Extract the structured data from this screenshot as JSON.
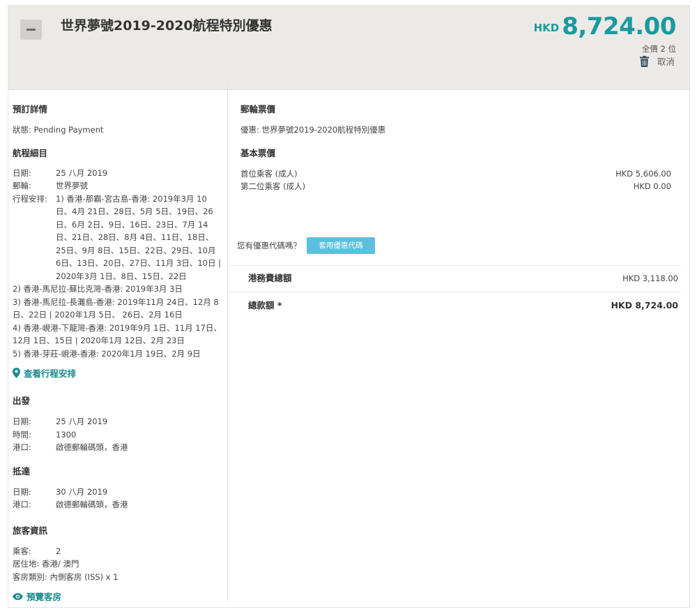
{
  "header": {
    "title": "世界夢號2019-2020航程特別優惠",
    "currency": "HKD",
    "amount": "8,724.00",
    "total_note": "全價 2 位",
    "cancel_label": "取消"
  },
  "booking": {
    "section_title": "預訂詳情",
    "status": "狀態: Pending Payment"
  },
  "voyage": {
    "section_title": "航程細目",
    "date_label": "日期:",
    "date_value": "25 八月 2019",
    "ship_label": "郵輪:",
    "ship_value": "世界夢號",
    "itinerary_label": "行程安排:",
    "itinerary_1": "1) 香港-那霸-宮古島-香港: 2019年3月 10日、4月 21日、28日、5月 5日、19日、26日、6月 2日、9日、16日、23日、7月 14日、21日、28日、8月 4日、11日、18日、25日、9月 8日、15日、22日、29日、10月 6日、13日、20日、27日、11月 3日、10日 | 2020年3月 1日、8日、15日、22日",
    "itinerary_2": "2) 香港-馬尼拉-蘇比克灣-香港: 2019年3月 3日",
    "itinerary_3a": "3) 香港-馬尼拉-長灘島-香港: 2019年11月 24日、12月 8",
    "itinerary_3b": "日、22日 | 2020年1月 5日、 26日、2月 16日",
    "itinerary_4a": "4) 香港-峴港-下龍灣-香港: 2019年9月 1日、11月 17日、",
    "itinerary_4b": "12月 1日、15日 | 2020年1月 12日、2月 23日",
    "itinerary_5": "5) 香港-芽莊-峴港-香港: 2020年1月 19日、2月 9日",
    "view_itinerary_link": "查看行程安排"
  },
  "departure": {
    "section_title": "出發",
    "date_label": "日期:",
    "date_value": "25 八月 2019",
    "time_label": "時間:",
    "time_value": "1300",
    "port_label": "港口:",
    "port_value": "啟德郵輪碼頭，香港"
  },
  "arrival": {
    "section_title": "抵達",
    "date_label": "日期:",
    "date_value": "30 八月 2019",
    "port_label": "港口:",
    "port_value": "啟德郵輪碼頭，香港"
  },
  "guest": {
    "section_title": "旅客資訊",
    "guests_label": "乘客:",
    "guests_value": "2",
    "residence": "居住地: 香港/ 澳門",
    "cabin_type": "客房類別: 內側客房 (ISS) x 1",
    "preview_cabin_link": "預覽客房"
  },
  "fare": {
    "section_title": "郵輪票價",
    "promotion": "優惠: 世界夢號2019-2020航程特別優惠",
    "base_title": "基本票價",
    "passenger_1_label": "首位乘客 (成人)",
    "passenger_1_amount": "HKD 5,606.00",
    "passenger_2_label": "第二位乘客 (成人)",
    "passenger_2_amount": "HKD 0.00",
    "promo_question": "您有優惠代碼嗎？",
    "promo_button": "套用優惠代碼",
    "port_fee_label": "港務費總額",
    "port_fee_amount": "HKD 3,118.00",
    "total_label": "總款額 *",
    "total_amount": "HKD 8,724.00"
  },
  "colors": {
    "accent": "#1a9a9e",
    "header_bg": "#ebeae7",
    "promo_button": "#5bc0de"
  }
}
